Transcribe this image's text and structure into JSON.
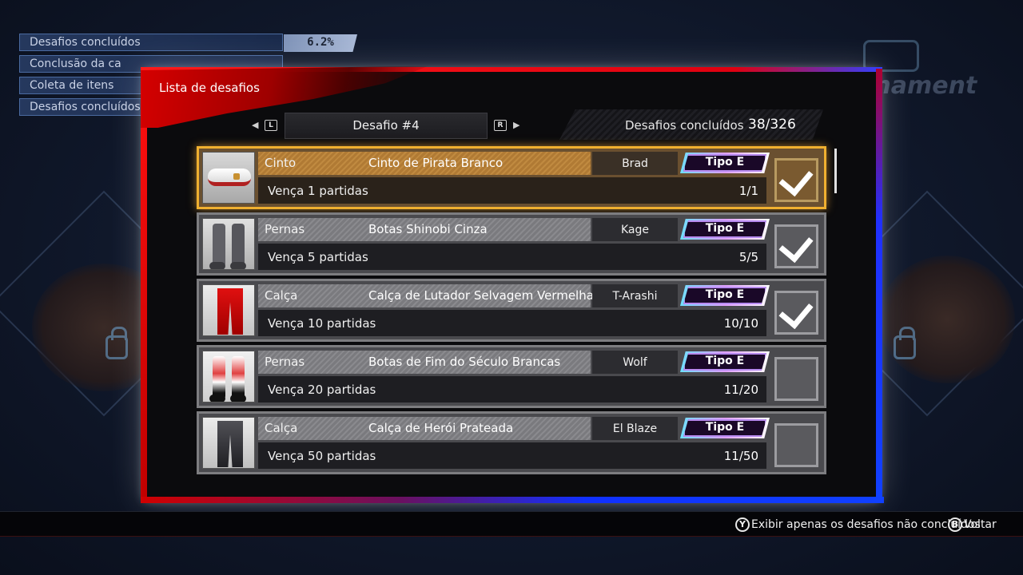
{
  "stats": {
    "rows": [
      {
        "label": "Desafios concluídos",
        "value": "6.2%"
      },
      {
        "label": "Conclusão da ca"
      },
      {
        "label": "Coleta de itens"
      },
      {
        "label": "Desafios concluídos"
      }
    ]
  },
  "dialog": {
    "title": "Lista de desafios",
    "selector": {
      "left_key": "L",
      "right_key": "R",
      "label": "Desafio #4"
    },
    "completed_label": "Desafios concluídos",
    "completed_count": "38/326"
  },
  "challenges": [
    {
      "category": "Cinto",
      "item": "Cinto de Pirata Branco",
      "character": "Brad",
      "type": "Tipo E",
      "goal": "Vença 1 partidas",
      "progress": "1/1",
      "done": true,
      "selected": true,
      "icon": "white-belt"
    },
    {
      "category": "Pernas",
      "item": "Botas Shinobi Cinza",
      "character": "Kage",
      "type": "Tipo E",
      "goal": "Vença 5 partidas",
      "progress": "5/5",
      "done": true,
      "selected": false,
      "icon": "grey-boots"
    },
    {
      "category": "Calça",
      "item": "Calça de Lutador Selvagem Vermelha",
      "character": "T-Arashi",
      "type": "Tipo E",
      "goal": "Vença 10 partidas",
      "progress": "10/10",
      "done": true,
      "selected": false,
      "icon": "red-pants"
    },
    {
      "category": "Pernas",
      "item": "Botas de Fim do Século Brancas",
      "character": "Wolf",
      "type": "Tipo E",
      "goal": "Vença 20 partidas",
      "progress": "11/20",
      "done": false,
      "selected": false,
      "icon": "white-boots"
    },
    {
      "category": "Calça",
      "item": "Calça de Herói Prateada",
      "character": "El Blaze",
      "type": "Tipo E",
      "goal": "Vença 50 partidas",
      "progress": "11/50",
      "done": false,
      "selected": false,
      "icon": "silver-pants"
    }
  ],
  "footer": {
    "y_button": "Y",
    "y_label": "Exibir apenas os desafios não concluídos",
    "b_button": "B",
    "b_label": "Voltar"
  },
  "colors": {
    "accent_red": "#e00010",
    "accent_blue": "#1040ff",
    "selected_border": "#f0b030"
  }
}
